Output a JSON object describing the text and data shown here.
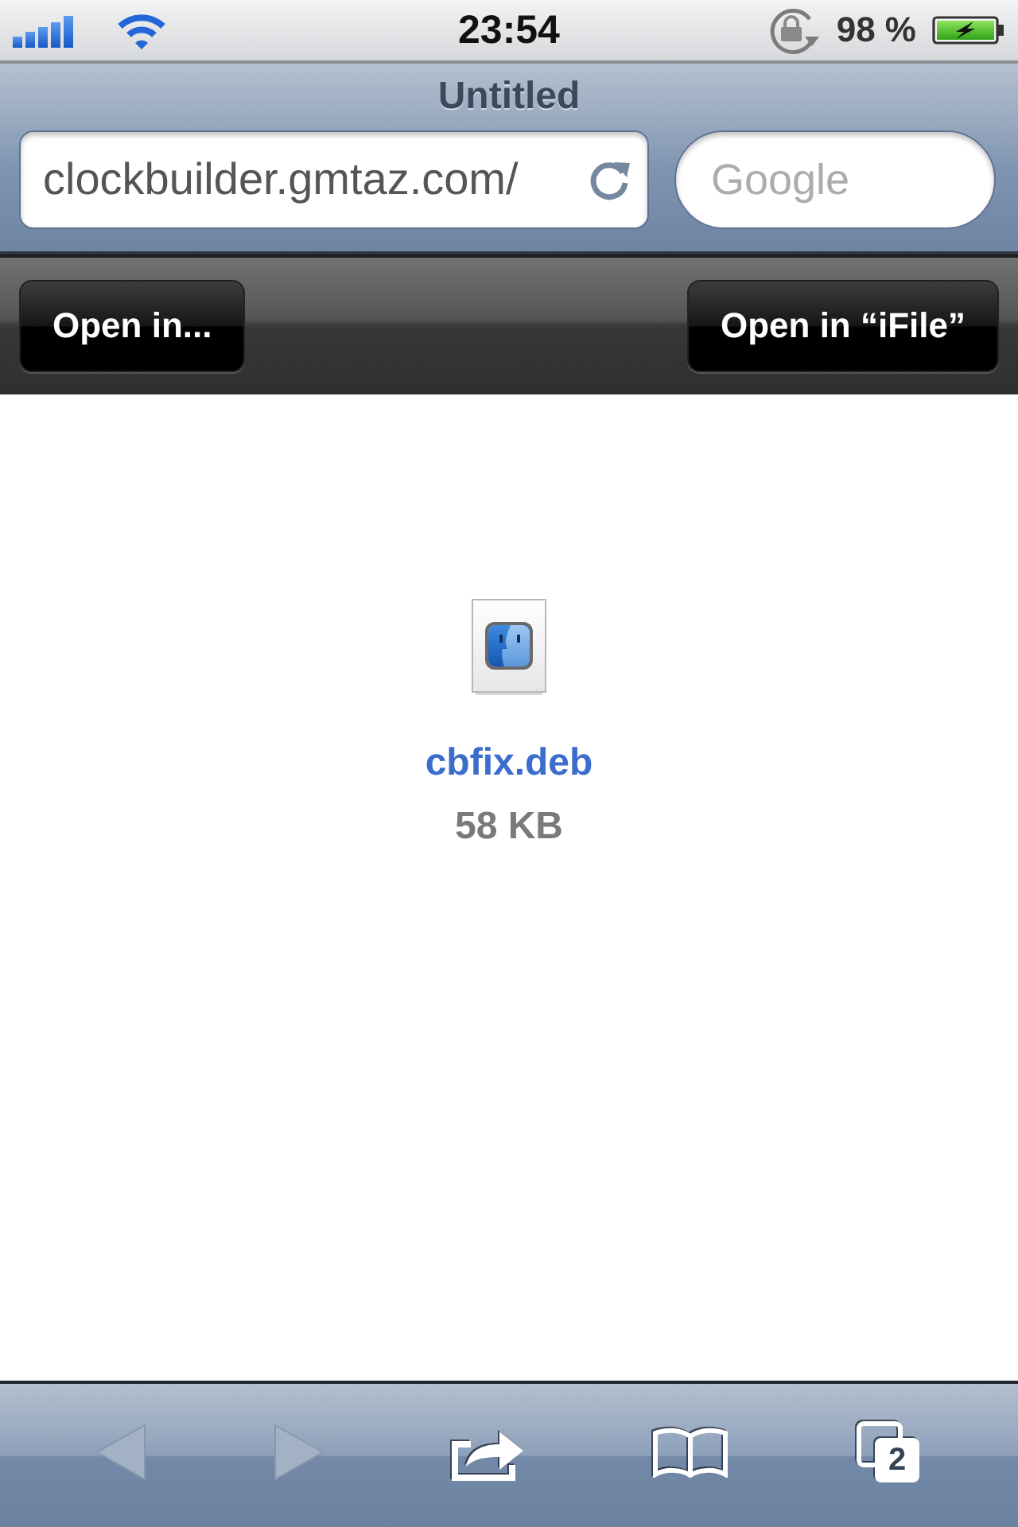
{
  "status_bar": {
    "time": "23:54",
    "battery_text": "98 %"
  },
  "browser": {
    "title": "Untitled",
    "address": {
      "value": "clockbuilder.gmtaz.com/"
    },
    "search": {
      "placeholder": "Google"
    }
  },
  "action_bar": {
    "buttons": [
      "Open in...",
      "Open in “iFile”"
    ]
  },
  "download": {
    "file_name": "cbfix.deb",
    "file_size": "58 KB"
  },
  "toolbar": {
    "items": [
      {
        "kind": "back",
        "disabled": true
      },
      {
        "kind": "forward",
        "disabled": true
      },
      {
        "kind": "share",
        "disabled": false
      },
      {
        "kind": "bookmarks",
        "disabled": false
      },
      {
        "kind": "tabs",
        "disabled": false,
        "badge": "2"
      }
    ]
  }
}
